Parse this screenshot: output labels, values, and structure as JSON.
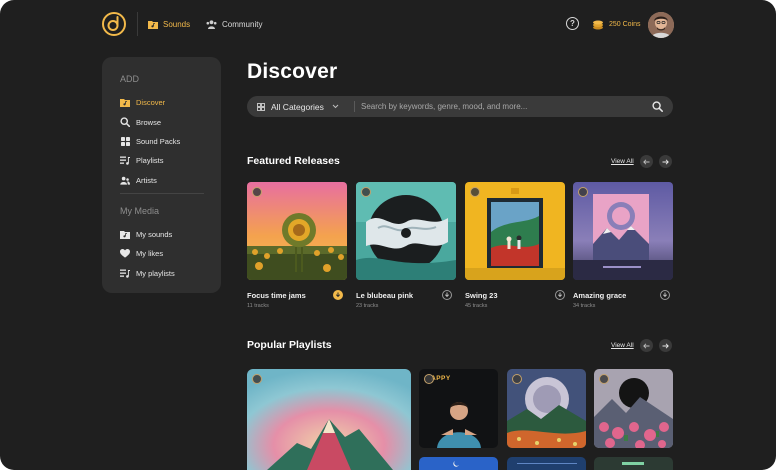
{
  "header": {
    "nav": [
      {
        "label": "Sounds",
        "icon": "folder-music-icon",
        "active": true
      },
      {
        "label": "Community",
        "icon": "users-icon",
        "active": false
      }
    ],
    "help_label": "?",
    "coins_label": "250 Coins"
  },
  "sidebar": {
    "section_add": "ADD",
    "items": [
      {
        "label": "Discover",
        "icon": "folder-music-icon",
        "active": true
      },
      {
        "label": "Browse",
        "icon": "search-icon"
      },
      {
        "label": "Sound Packs",
        "icon": "grid-icon"
      },
      {
        "label": "Playlists",
        "icon": "playlist-icon"
      },
      {
        "label": "Artists",
        "icon": "users-icon"
      }
    ],
    "section_media": "My Media",
    "media_items": [
      {
        "label": "My sounds",
        "icon": "folder-music-icon"
      },
      {
        "label": "My likes",
        "icon": "heart-icon"
      },
      {
        "label": "My playlists",
        "icon": "playlist-icon"
      }
    ]
  },
  "main": {
    "title": "Discover",
    "search": {
      "category": "All Categories",
      "placeholder": "Search by keywords, genre, mood, and more..."
    },
    "featured": {
      "title": "Featured Releases",
      "view_all": "View All",
      "cards": [
        {
          "title": "Focus time jams",
          "tracks": "11 tracks",
          "downloaded": true
        },
        {
          "title": "Le blubeau pink",
          "tracks": "23 tracks",
          "downloaded": false
        },
        {
          "title": "Swing 23",
          "tracks": "45 tracks",
          "downloaded": false
        },
        {
          "title": "Amazing grace",
          "tracks": "34 tracks",
          "downloaded": false
        }
      ]
    },
    "playlists": {
      "title": "Popular Playlists",
      "view_all": "View All",
      "cover_text": "APPY"
    }
  },
  "colors": {
    "accent": "#f2b94a",
    "background": "#1f1f1f",
    "panel": "#2f2f2f"
  }
}
